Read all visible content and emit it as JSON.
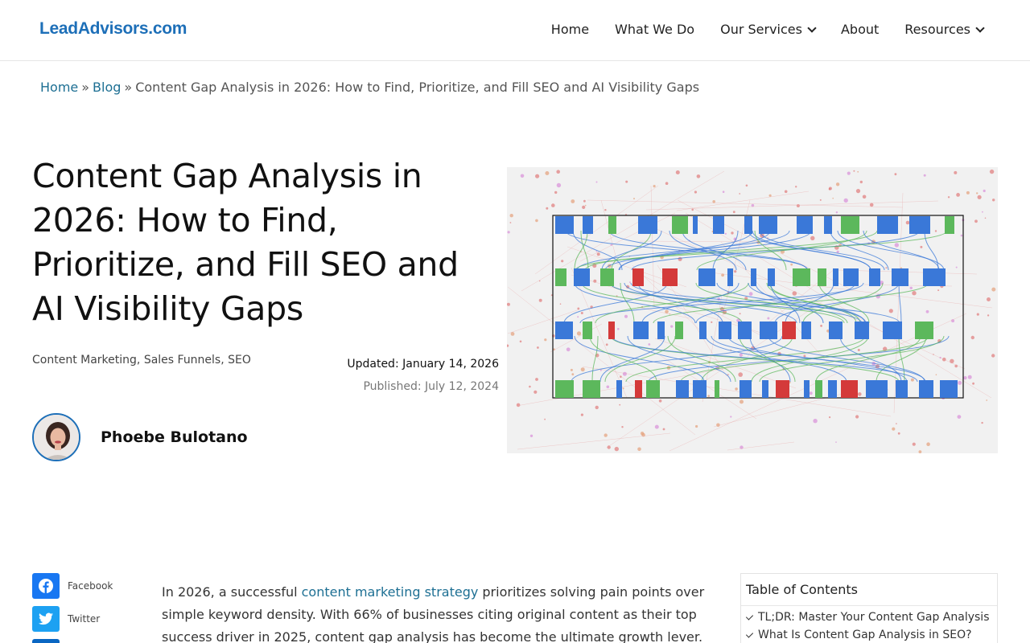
{
  "header": {
    "logo": "LeadAdvisors.com",
    "nav": [
      {
        "label": "Home",
        "dropdown": false
      },
      {
        "label": "What We Do",
        "dropdown": false
      },
      {
        "label": "Our Services",
        "dropdown": true
      },
      {
        "label": "About",
        "dropdown": false
      },
      {
        "label": "Resources",
        "dropdown": true
      }
    ]
  },
  "breadcrumb": {
    "home": "Home",
    "blog": "Blog",
    "sep": "»",
    "current": "Content Gap Analysis in 2026: How to Find, Prioritize, and Fill SEO and AI Visibility Gaps"
  },
  "post": {
    "title": "Content Gap Analysis in 2026: How to Find, Prioritize, and Fill SEO and AI Visibility Gaps",
    "categories": [
      "Content Marketing",
      "Sales Funnels",
      "SEO"
    ],
    "updated_label": "Updated:",
    "updated": "January 14, 2026",
    "published_label": "Published:",
    "published": "July 12, 2024",
    "author": "Phoebe Bulotano"
  },
  "share": [
    {
      "label": "Facebook",
      "icon": "facebook-icon"
    },
    {
      "label": "Twitter",
      "icon": "twitter-icon"
    },
    {
      "label": "",
      "icon": "linkedin-icon"
    }
  ],
  "article": {
    "p1_before": "In 2026, a successful ",
    "p1_link": "content marketing strategy",
    "p1_after": " prioritizes solving pain points over simple keyword density. With 66% of businesses citing original content as their top success driver in 2025, content gap analysis has become the ultimate growth lever. By comparing your"
  },
  "toc": {
    "title": "Table of Contents",
    "items": [
      "TL;DR: Master Your Content Gap Analysis",
      "What Is Content Gap Analysis in SEO?"
    ]
  },
  "colors": {
    "brand": "#1d6fb8",
    "link": "#1d6f93",
    "diagram_blue": "#3a78d8",
    "diagram_green": "#5cb85c",
    "diagram_red": "#d43a3a"
  }
}
